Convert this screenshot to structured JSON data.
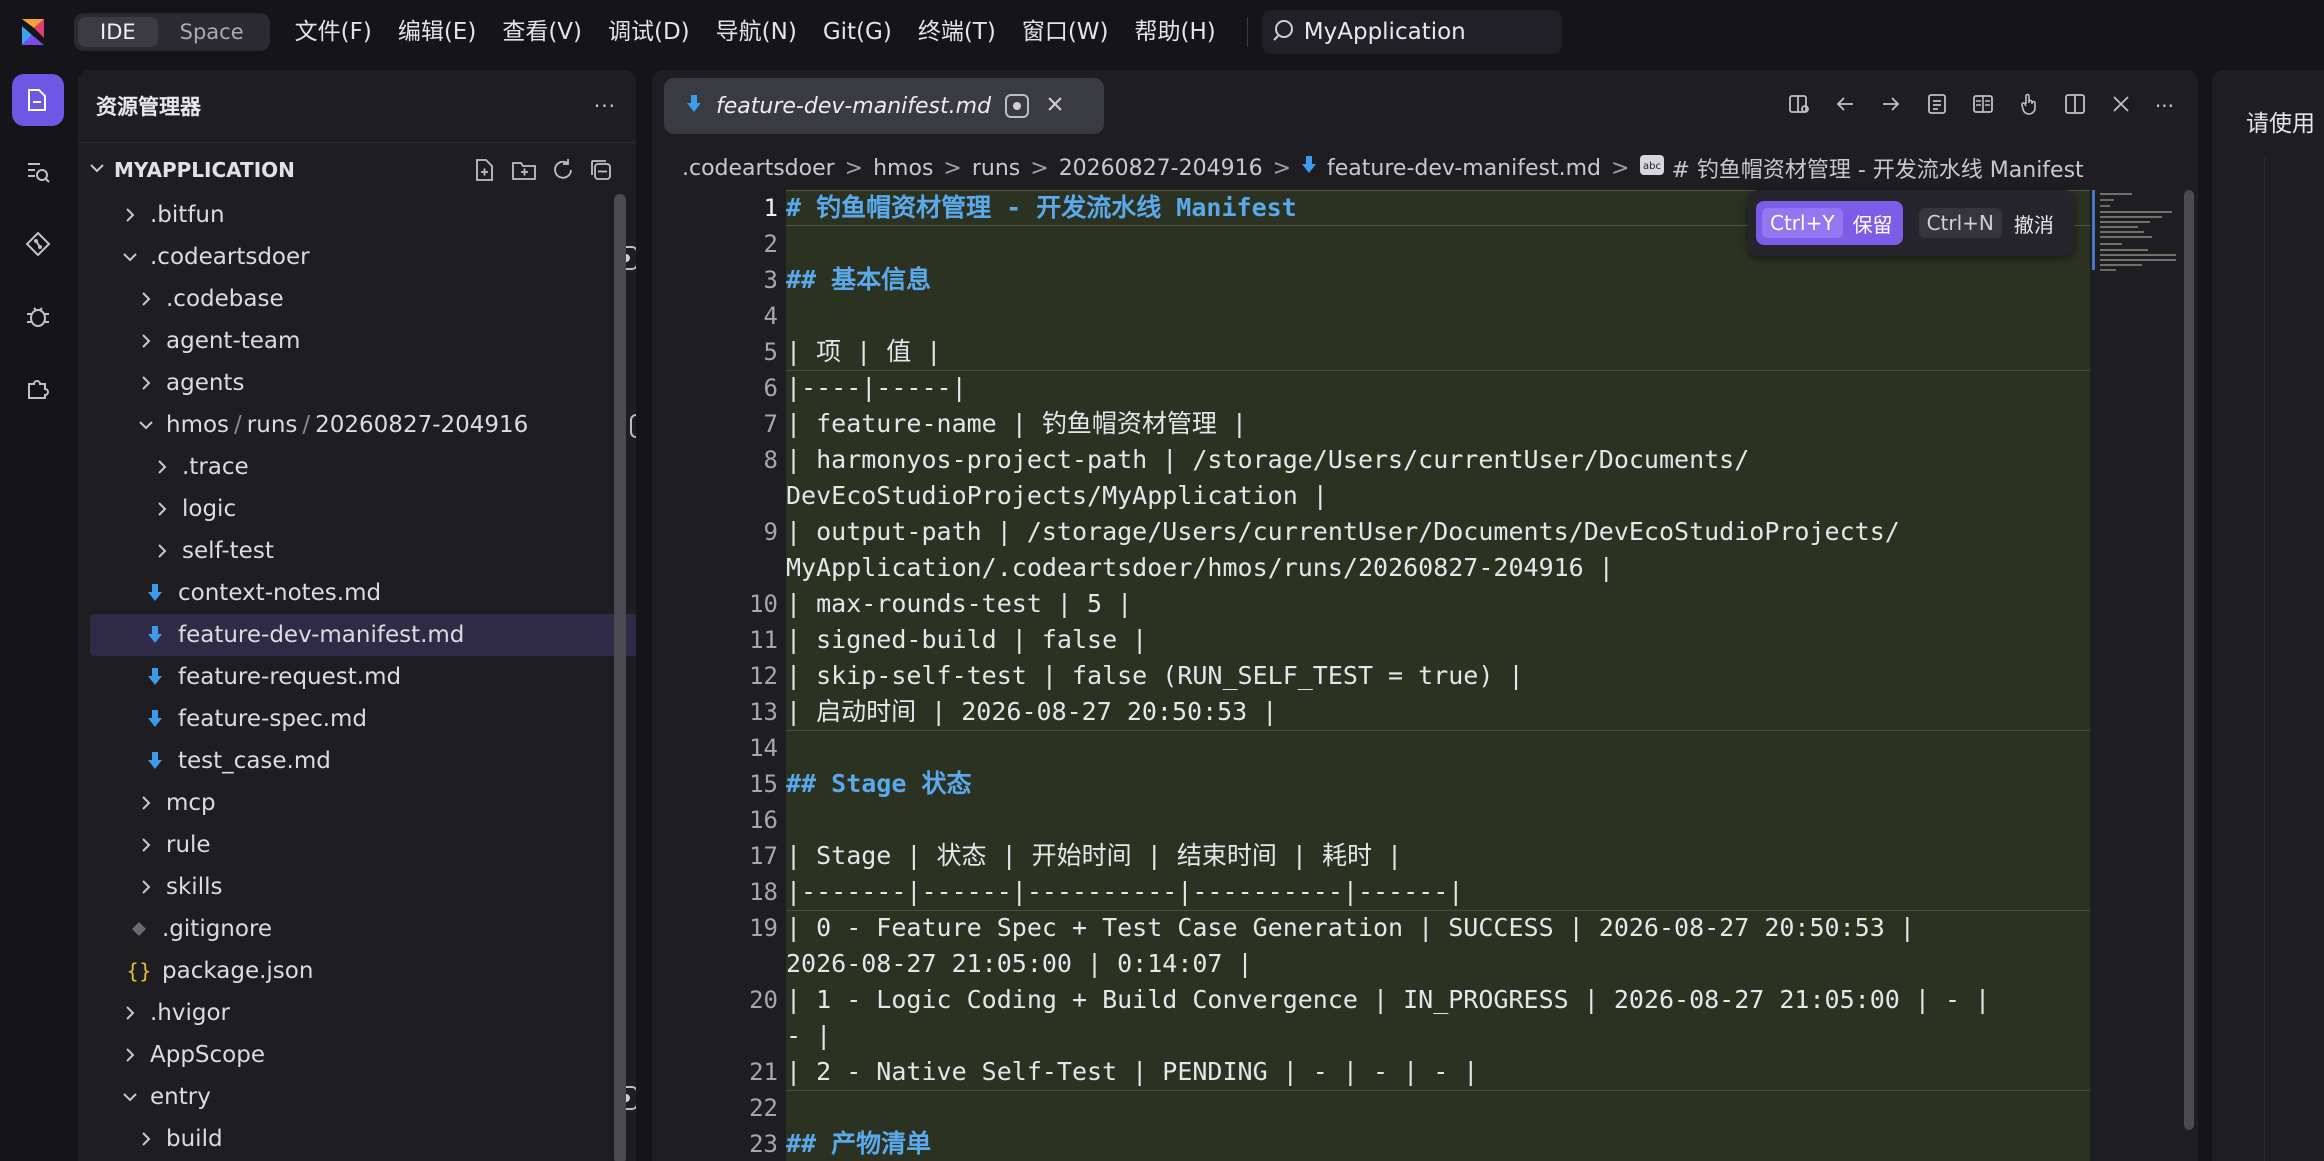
{
  "titlebar": {
    "modes": [
      "IDE",
      "Space"
    ],
    "menu": [
      "文件(F)",
      "编辑(E)",
      "查看(V)",
      "调试(D)",
      "导航(N)",
      "Git(G)",
      "终端(T)",
      "窗口(W)",
      "帮助(H)"
    ],
    "search_value": "MyApplication"
  },
  "sidebar": {
    "title": "资源管理器",
    "more": "···",
    "root": "MYAPPLICATION",
    "tree": [
      {
        "label": ".bitfun"
      },
      {
        "label": ".codeartsdoer"
      },
      {
        "label": ".codebase"
      },
      {
        "label": "agent-team"
      },
      {
        "label": "agents"
      },
      {
        "seg1": "hmos",
        "seg2": "runs",
        "seg3": "20260827-204916"
      },
      {
        "label": ".trace"
      },
      {
        "label": "logic"
      },
      {
        "label": "self-test"
      },
      {
        "label": "context-notes.md"
      },
      {
        "label": "feature-dev-manifest.md"
      },
      {
        "label": "feature-request.md"
      },
      {
        "label": "feature-spec.md"
      },
      {
        "label": "test_case.md"
      },
      {
        "label": "mcp"
      },
      {
        "label": "rule"
      },
      {
        "label": "skills"
      },
      {
        "label": ".gitignore"
      },
      {
        "label": "package.json"
      },
      {
        "label": ".hvigor"
      },
      {
        "label": "AppScope"
      },
      {
        "label": "entry"
      },
      {
        "label": "build"
      }
    ]
  },
  "editor": {
    "tab_label": "feature-dev-manifest.md",
    "breadcrumb": [
      ".codeartsdoer",
      "hmos",
      "runs",
      "20260827-204916",
      "feature-dev-manifest.md",
      "# 钓鱼帽资材管理 - 开发流水线 Manifest"
    ],
    "lines": [
      {
        "n": "1",
        "t": "# 钓鱼帽资材管理 - 开发流水线 Manifest"
      },
      {
        "n": "2",
        "t": ""
      },
      {
        "n": "3",
        "t": "## 基本信息"
      },
      {
        "n": "4",
        "t": ""
      },
      {
        "n": "5",
        "t": "| 项 | 值 |"
      },
      {
        "n": "6",
        "t": "|----|-----|"
      },
      {
        "n": "7",
        "t": "| feature-name | 钓鱼帽资材管理 |"
      },
      {
        "n": "8",
        "t": "| harmonyos-project-path | /storage/Users/currentUser/Documents/",
        "t2": "DevEcoStudioProjects/MyApplication |"
      },
      {
        "n": "9",
        "t": "| output-path | /storage/Users/currentUser/Documents/DevEcoStudioProjects/",
        "t2": "MyApplication/.codeartsdoer/hmos/runs/20260827-204916 |"
      },
      {
        "n": "10",
        "t": "| max-rounds-test | 5 |"
      },
      {
        "n": "11",
        "t": "| signed-build | false |"
      },
      {
        "n": "12",
        "t": "| skip-self-test | false (RUN_SELF_TEST = true) |"
      },
      {
        "n": "13",
        "t": "| 启动时间 | 2026-08-27 20:50:53 |"
      },
      {
        "n": "14",
        "t": ""
      },
      {
        "n": "15",
        "t": "## Stage 状态"
      },
      {
        "n": "16",
        "t": ""
      },
      {
        "n": "17",
        "t": "| Stage | 状态 | 开始时间 | 结束时间 | 耗时 |"
      },
      {
        "n": "18",
        "t": "|-------|------|----------|----------|------|"
      },
      {
        "n": "19",
        "t": "| 0 - Feature Spec + Test Case Generation | SUCCESS | 2026-08-27 20:50:53 |",
        "t2": "2026-08-27 21:05:00 | 0:14:07 |"
      },
      {
        "n": "20",
        "t": "| 1 - Logic Coding + Build Convergence | IN_PROGRESS | 2026-08-27 21:05:00 | - |",
        "t2": "- |"
      },
      {
        "n": "21",
        "t": "| 2 - Native Self-Test | PENDING | - | - | - |"
      },
      {
        "n": "22",
        "t": ""
      },
      {
        "n": "23",
        "t": "## 产物清单"
      }
    ],
    "accept": {
      "keep_key": "Ctrl+Y",
      "keep_label": "保留",
      "undo_key": "Ctrl+N",
      "undo_label": "撤消"
    }
  },
  "right_panel": {
    "text": "请使用"
  }
}
